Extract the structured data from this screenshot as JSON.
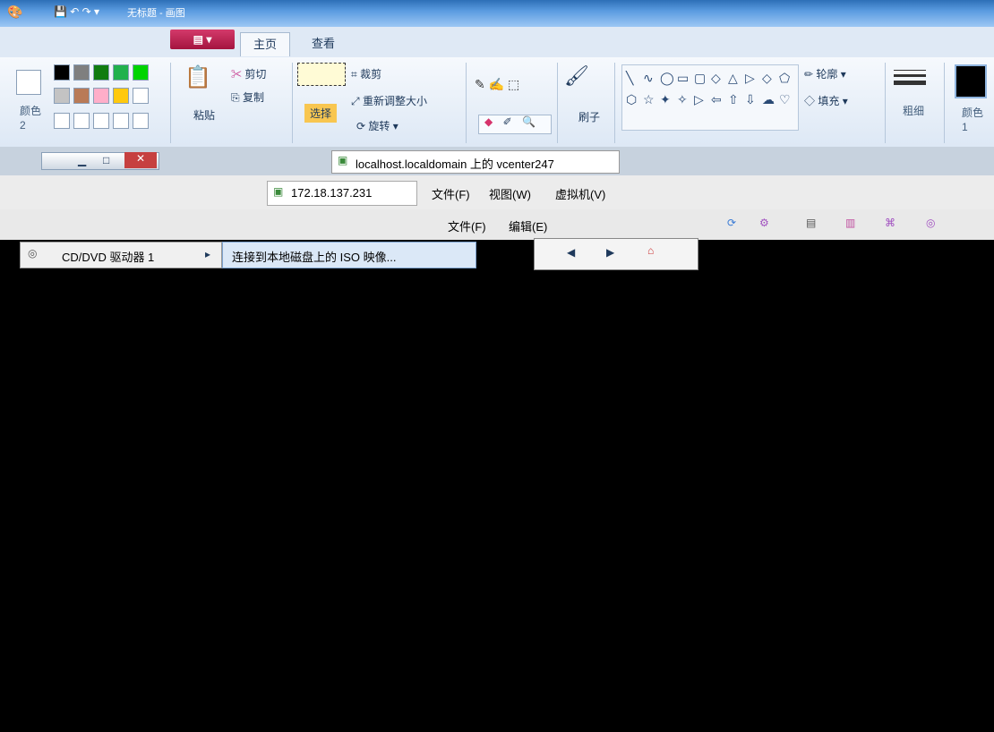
{
  "title_bar": {
    "title": "无标题 - 画图"
  },
  "ribbon": {
    "app_button": "▤ ▾",
    "tabs": [
      {
        "label": "主页"
      },
      {
        "label": "查看"
      }
    ],
    "clipboard": {
      "paste": "粘贴",
      "cut": "剪切",
      "copy": "复制"
    },
    "image": {
      "select": "选择",
      "crop": "裁剪",
      "resize": "重新调整大小",
      "rotate": "旋转"
    },
    "tools": {
      "brushes": "刷子"
    },
    "shapes": {
      "outline": "轮廓",
      "fill": "填充"
    },
    "size": {
      "label": "粗细"
    },
    "colors": {
      "color1": "颜色 1",
      "color2": "颜色 2"
    },
    "palette_colors": [
      "#000000",
      "#7f7f7f",
      "#107c10",
      "#22b14c",
      "#00d400",
      "#c3c3c3",
      "#b97a57",
      "#ffaec9",
      "#ffc90e",
      "#ffffff"
    ]
  },
  "vm_window_1": {
    "title": "localhost.localdomain 上的 vcenter247"
  },
  "vm_window_2": {
    "host": "172.18.137.231",
    "menu": {
      "file": "文件(F)",
      "view": "视图(W)",
      "vm": "虚拟机(V)"
    }
  },
  "vm_window_3": {
    "menu": {
      "file": "文件(F)",
      "edit": "编辑(E)"
    }
  },
  "context_menu": {
    "item": "CD/DVD 驱动器 1",
    "submenu_item": "连接到本地磁盘上的 ISO 映像..."
  }
}
